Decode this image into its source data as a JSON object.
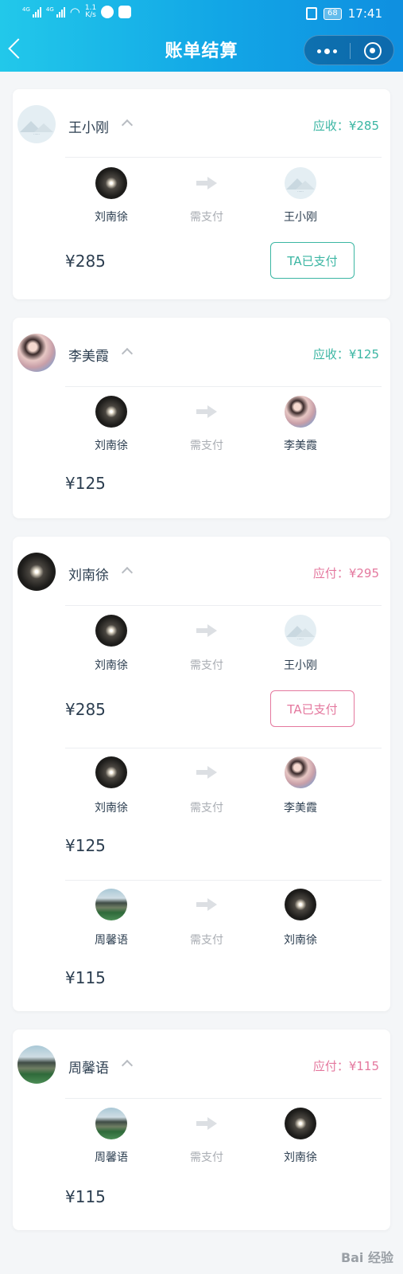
{
  "status_bar": {
    "signal1_tag": "4G",
    "signal2_tag": "4G",
    "speed_value": "1.1",
    "speed_unit": "K/s",
    "battery": "68",
    "time": "17:41"
  },
  "navbar": {
    "title": "账单结算",
    "back_icon": "chevron-left-icon",
    "more_icon": "more-dots-icon",
    "target_icon": "target-icon"
  },
  "transfer_label": "需支付",
  "cards": [
    {
      "name": "王小刚",
      "amount_label": "应收：¥285",
      "status": "receivable",
      "transactions": [
        {
          "payer": "刘南徐",
          "payee": "王小刚",
          "amount": "¥285",
          "button": "TA已支付"
        }
      ]
    },
    {
      "name": "李美霞",
      "amount_label": "应收：¥125",
      "status": "receivable",
      "transactions": [
        {
          "payer": "刘南徐",
          "payee": "李美霞",
          "amount": "¥125"
        }
      ]
    },
    {
      "name": "刘南徐",
      "amount_label": "应付：¥295",
      "status": "payable",
      "transactions": [
        {
          "payer": "刘南徐",
          "payee": "王小刚",
          "amount": "¥285",
          "button": "TA已支付"
        },
        {
          "payer": "刘南徐",
          "payee": "李美霞",
          "amount": "¥125"
        },
        {
          "payer": "周馨语",
          "payee": "刘南徐",
          "amount": "¥115"
        }
      ]
    },
    {
      "name": "周馨语",
      "amount_label": "应付：¥115",
      "status": "payable",
      "transactions": [
        {
          "payer": "周馨语",
          "payee": "刘南徐",
          "amount": "¥115"
        }
      ]
    }
  ],
  "colors": {
    "header_start": "#22c8ea",
    "header_end": "#0f8fe0",
    "receivable": "#3bb6a3",
    "payable": "#e4789e"
  },
  "watermark": "Bai 经验"
}
